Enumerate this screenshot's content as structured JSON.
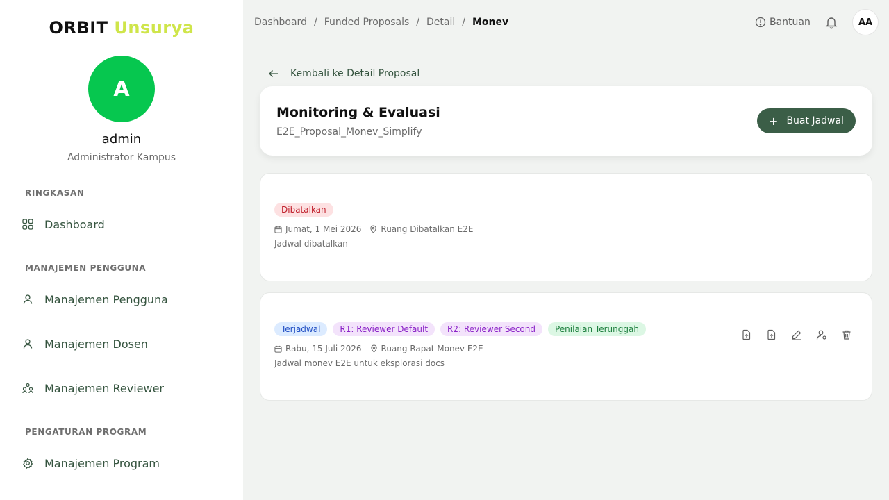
{
  "sidebar": {
    "brand_primary": "ORBIT",
    "brand_secondary": "Unsurya",
    "avatar_letter": "A",
    "user_name": "admin",
    "user_role": "Administrator Kampus",
    "sections": [
      {
        "label": "RINGKASAN",
        "items": [
          {
            "label": "Dashboard",
            "icon": "grid-icon"
          }
        ]
      },
      {
        "label": "MANAJEMEN PENGGUNA",
        "items": [
          {
            "label": "Manajemen Pengguna",
            "icon": "user-icon"
          },
          {
            "label": "Manajemen Dosen",
            "icon": "user-icon"
          },
          {
            "label": "Manajemen Reviewer",
            "icon": "users-icon"
          }
        ]
      },
      {
        "label": "PENGATURAN PROGRAM",
        "items": [
          {
            "label": "Manajemen Program",
            "icon": "gear-icon"
          }
        ]
      }
    ]
  },
  "topbar": {
    "breadcrumb": [
      "Dashboard",
      "Funded Proposals",
      "Detail",
      "Monev"
    ],
    "breadcrumb_separator": "/",
    "help_label": "Bantuan",
    "avatar_initials": "AA"
  },
  "back_link": "Kembali ke Detail Proposal",
  "header": {
    "title": "Monitoring & Evaluasi",
    "subtitle": "E2E_Proposal_Monev_Simplify",
    "create_button": "Buat Jadwal"
  },
  "schedules": [
    {
      "badges": [
        {
          "label": "Dibatalkan",
          "color": "#c0202c"
        }
      ],
      "date": "Jumat, 1 Mei 2026",
      "location": "Ruang Dibatalkan E2E",
      "description": "Jadwal dibatalkan"
    },
    {
      "badges": [
        {
          "label": "Terjadwal",
          "color": "#2350c4"
        },
        {
          "label": "R1: Reviewer Default",
          "color": "#8a22c7"
        },
        {
          "label": "R2: Reviewer Second",
          "color": "#8a22c7"
        },
        {
          "label": "Penilaian Terunggah",
          "color": "#1d7f3e"
        }
      ],
      "date": "Rabu, 15 Juli 2026",
      "location": "Ruang Rapat Monev E2E",
      "description": "Jadwal monev E2E untuk eksplorasi docs",
      "actions": [
        "upload-file-icon",
        "upload-file-icon",
        "edit-icon",
        "assign-reviewer-icon",
        "trash-icon"
      ]
    }
  ],
  "colors": {
    "accent": "#3b5e47",
    "brand_accent": "#cfe54a",
    "avatar_green": "#06c74f"
  }
}
